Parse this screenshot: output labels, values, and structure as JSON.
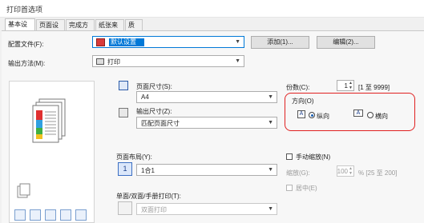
{
  "window": {
    "title": "打印首选项"
  },
  "tabs": [
    "基本设置",
    "页面设置",
    "完成方式",
    "纸张来源",
    "质量"
  ],
  "profile": {
    "label": "配置文件(F):",
    "value": "默认设置",
    "add_label": "添加(1)...",
    "edit_label": "编辑(2)..."
  },
  "output_method": {
    "label": "输出方法(M):",
    "value": "打印"
  },
  "page_size": {
    "label": "页面尺寸(S):",
    "value": "A4"
  },
  "output_size": {
    "label": "输出尺寸(Z):",
    "value": "匹配页面尺寸"
  },
  "copies": {
    "label": "份数(C):",
    "value": "1",
    "range": "[1 至 9999]"
  },
  "orientation": {
    "label": "方向(O)",
    "portrait": "纵向",
    "landscape": "横向",
    "selected": "portrait"
  },
  "page_layout": {
    "label": "页面布局(Y):",
    "value": "1合1",
    "icon_text": "1"
  },
  "manual_scaling": {
    "label": "手动缩放(N)",
    "checked": false
  },
  "scaling": {
    "label": "缩放(G):",
    "value": "100",
    "range": "% [25 至 200]"
  },
  "center": {
    "label": "居中(E)",
    "disabled": true
  },
  "duplex": {
    "label": "单面/双面/手册打印(T):",
    "value": "双面打印"
  }
}
